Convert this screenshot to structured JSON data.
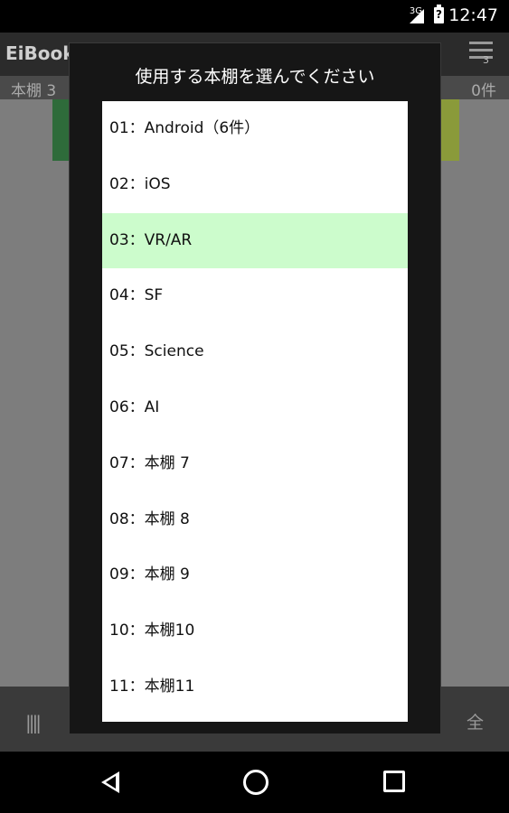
{
  "status_bar": {
    "network": "3G",
    "time": "12:47"
  },
  "app_bar": {
    "title": "EiBooks",
    "badge": "3"
  },
  "sub_bar": {
    "shelf": "本棚 3",
    "count": "0件"
  },
  "bottom_bar": {
    "all_label": "全"
  },
  "dialog": {
    "title": "使用する本棚を選んでください",
    "items": [
      {
        "label": "01：Android（6件）"
      },
      {
        "label": "02：iOS"
      },
      {
        "label": "03：VR/AR"
      },
      {
        "label": "04：SF"
      },
      {
        "label": "05：Science"
      },
      {
        "label": "06：AI"
      },
      {
        "label": "07：本棚 7"
      },
      {
        "label": "08：本棚 8"
      },
      {
        "label": "09：本棚 9"
      },
      {
        "label": "10：本棚10"
      },
      {
        "label": "11：本棚11"
      }
    ],
    "selected_index": 2,
    "selected_color": "#ccfccc"
  }
}
